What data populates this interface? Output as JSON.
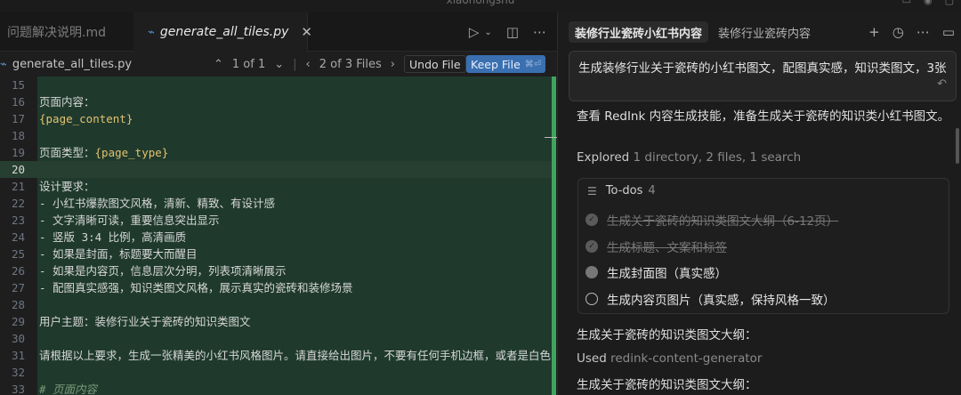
{
  "window": {
    "title": "xiaohongshu"
  },
  "editor": {
    "tabs": [
      {
        "label": "问题解决说明.md",
        "active": false
      },
      {
        "label": "generate_all_tiles.py",
        "active": true
      }
    ],
    "breadcrumb": {
      "file": "generate_all_tiles.py"
    },
    "diff_nav": {
      "hunk": "1 of 1",
      "files": "2 of 3 Files"
    },
    "undo_label": "Undo File",
    "keep_label": "Keep File",
    "keep_shortcut": "⌘⏎",
    "lines": [
      {
        "n": "15",
        "text": "",
        "cls": "c-text"
      },
      {
        "n": "16",
        "text": "页面内容：",
        "cls": "c-text"
      },
      {
        "n": "17",
        "text": "{page_content}",
        "cls": "c-var"
      },
      {
        "n": "18",
        "text": "",
        "cls": "c-text"
      },
      {
        "n": "19",
        "text": "页面类型：",
        "var": "{page_type}",
        "cls": "c-text"
      },
      {
        "n": "20",
        "text": "",
        "cls": "c-text",
        "current": true
      },
      {
        "n": "21",
        "text": "设计要求：",
        "cls": "c-text"
      },
      {
        "n": "22",
        "text": "- 小红书爆款图文风格，清新、精致、有设计感",
        "cls": "c-text"
      },
      {
        "n": "23",
        "text": "- 文字清晰可读，重要信息突出显示",
        "cls": "c-text"
      },
      {
        "n": "24",
        "text": "- 竖版 3:4 比例，高清画质",
        "cls": "c-text"
      },
      {
        "n": "25",
        "text": "- 如果是封面，标题要大而醒目",
        "cls": "c-text"
      },
      {
        "n": "26",
        "text": "- 如果是内容页，信息层次分明，列表项清晰展示",
        "cls": "c-text"
      },
      {
        "n": "27",
        "text": "- 配图真实感强，知识类图文风格，展示真实的瓷砖和装修场景",
        "cls": "c-text"
      },
      {
        "n": "28",
        "text": "",
        "cls": "c-text"
      },
      {
        "n": "29",
        "text": "用户主题：装修行业关于瓷砖的知识类图文",
        "cls": "c-text"
      },
      {
        "n": "30",
        "text": "",
        "cls": "c-text"
      },
      {
        "n": "31",
        "text": "请根据以上要求，生成一张精美的小红书风格图片。请直接给出图片，不要有任何手机边框，或者是白色",
        "cls": "c-text"
      },
      {
        "n": "32",
        "text": "",
        "cls": "c-text"
      },
      {
        "n": "33",
        "text": "# 页面内容",
        "cls": "c-cm"
      }
    ]
  },
  "chat": {
    "tabs": [
      {
        "label": "装修行业瓷砖小红书内容",
        "active": true
      },
      {
        "label": "装修行业瓷砖内容",
        "active": false
      }
    ],
    "prompt": "生成装修行业关于瓷砖的小红书图文，配图真实感，知识类图文，3张",
    "reply_1": "查看 RedInk 内容生成技能，准备生成关于瓷砖的知识类小红书图文。",
    "explored": {
      "label": "Explored",
      "detail": "1 directory, 2 files, 1 search"
    },
    "todos": {
      "title": "To-dos",
      "count": "4",
      "items": [
        {
          "text": "生成关于瓷砖的知识类图文大纲（6-12页）",
          "state": "done"
        },
        {
          "text": "生成标题、文案和标签",
          "state": "done"
        },
        {
          "text": "生成封面图（真实感）",
          "state": "progress"
        },
        {
          "text": "生成内容页图片（真实感，保持风格一致）",
          "state": "open"
        }
      ]
    },
    "outline_1": "生成关于瓷砖的知识类图文大纲：",
    "used": {
      "label": "Used",
      "detail": "redink-content-generator"
    },
    "outline_2": "生成关于瓷砖的知识类图文大纲："
  }
}
